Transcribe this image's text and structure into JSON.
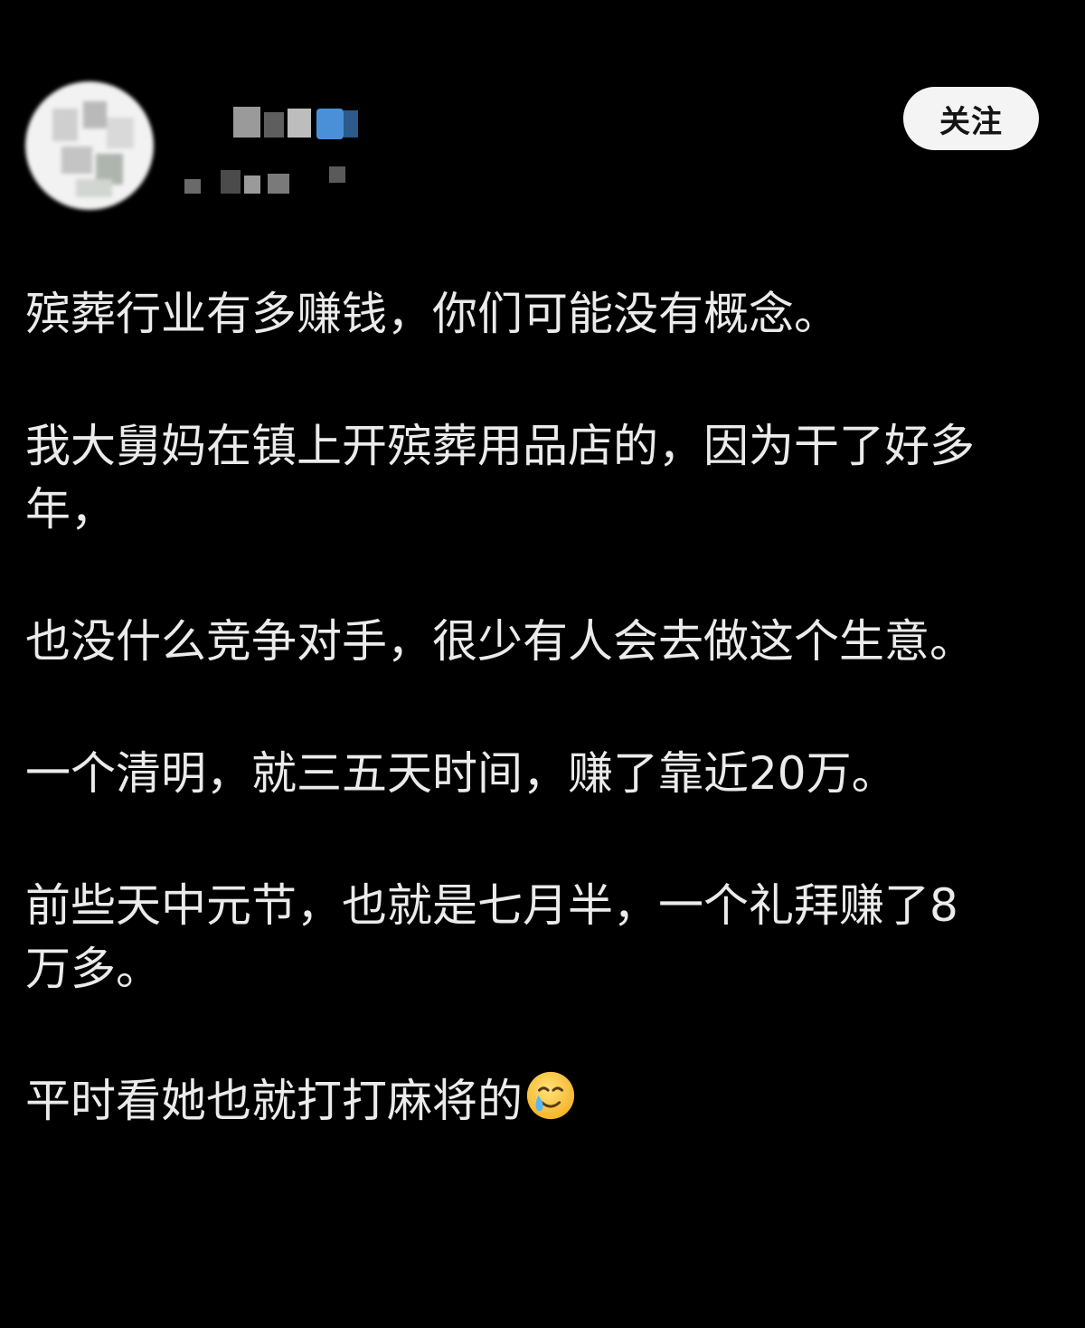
{
  "header": {
    "follow_label": "关注",
    "icons": {
      "avatar": "avatar-mosaic",
      "verified": "blurred-badge"
    }
  },
  "post": {
    "paragraphs": [
      "殡葬行业有多赚钱，你们可能没有概念。",
      "我大舅妈在镇上开殡葬用品店的，因为干了好多\n年，",
      "也没什么竞争对手，很少有人会去做这个生意。",
      "一个清明，就三五天时间，赚了靠近20万。",
      "前些天中元节，也就是七月半，一个礼拜赚了8\n万多。",
      "平时看她也就打打麻将的"
    ],
    "trailing_emoji": "smiling-face-with-tear-icon"
  },
  "colors": {
    "background": "#000000",
    "text": "#ebebeb",
    "button_bg": "#f4f4f4",
    "button_text": "#141414",
    "badge_blue": "#4a90d9"
  }
}
